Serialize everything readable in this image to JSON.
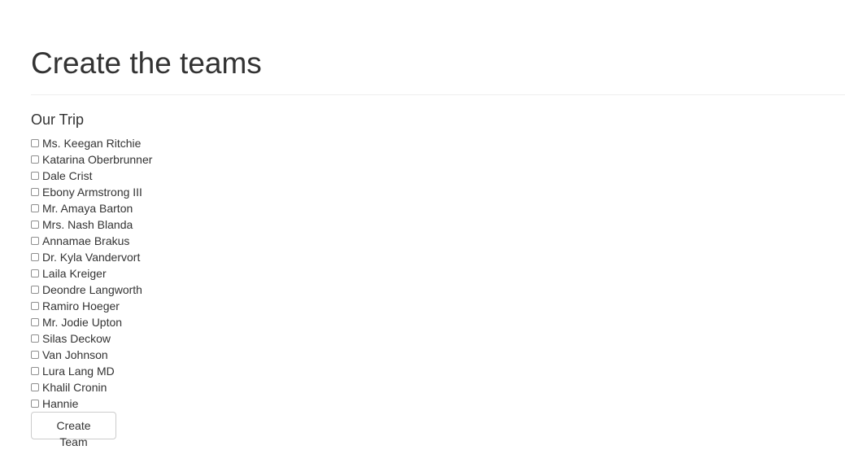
{
  "page": {
    "title": "Create the teams"
  },
  "trip": {
    "heading": "Our Trip",
    "members": [
      {
        "name": "Ms. Keegan Ritchie",
        "checked": false
      },
      {
        "name": "Katarina Oberbrunner",
        "checked": false
      },
      {
        "name": "Dale Crist",
        "checked": false
      },
      {
        "name": "Ebony Armstrong III",
        "checked": false
      },
      {
        "name": "Mr. Amaya Barton",
        "checked": false
      },
      {
        "name": "Mrs. Nash Blanda",
        "checked": false
      },
      {
        "name": "Annamae Brakus",
        "checked": false
      },
      {
        "name": "Dr. Kyla Vandervort",
        "checked": false
      },
      {
        "name": "Laila Kreiger",
        "checked": false
      },
      {
        "name": "Deondre Langworth",
        "checked": false
      },
      {
        "name": "Ramiro Hoeger",
        "checked": false
      },
      {
        "name": "Mr. Jodie Upton",
        "checked": false
      },
      {
        "name": "Silas Deckow",
        "checked": false
      },
      {
        "name": "Van Johnson",
        "checked": false
      },
      {
        "name": "Lura Lang MD",
        "checked": false
      },
      {
        "name": "Khalil Cronin",
        "checked": false
      },
      {
        "name": "Hannie",
        "checked": false
      }
    ]
  },
  "actions": {
    "create_team_label": "Create Team"
  }
}
